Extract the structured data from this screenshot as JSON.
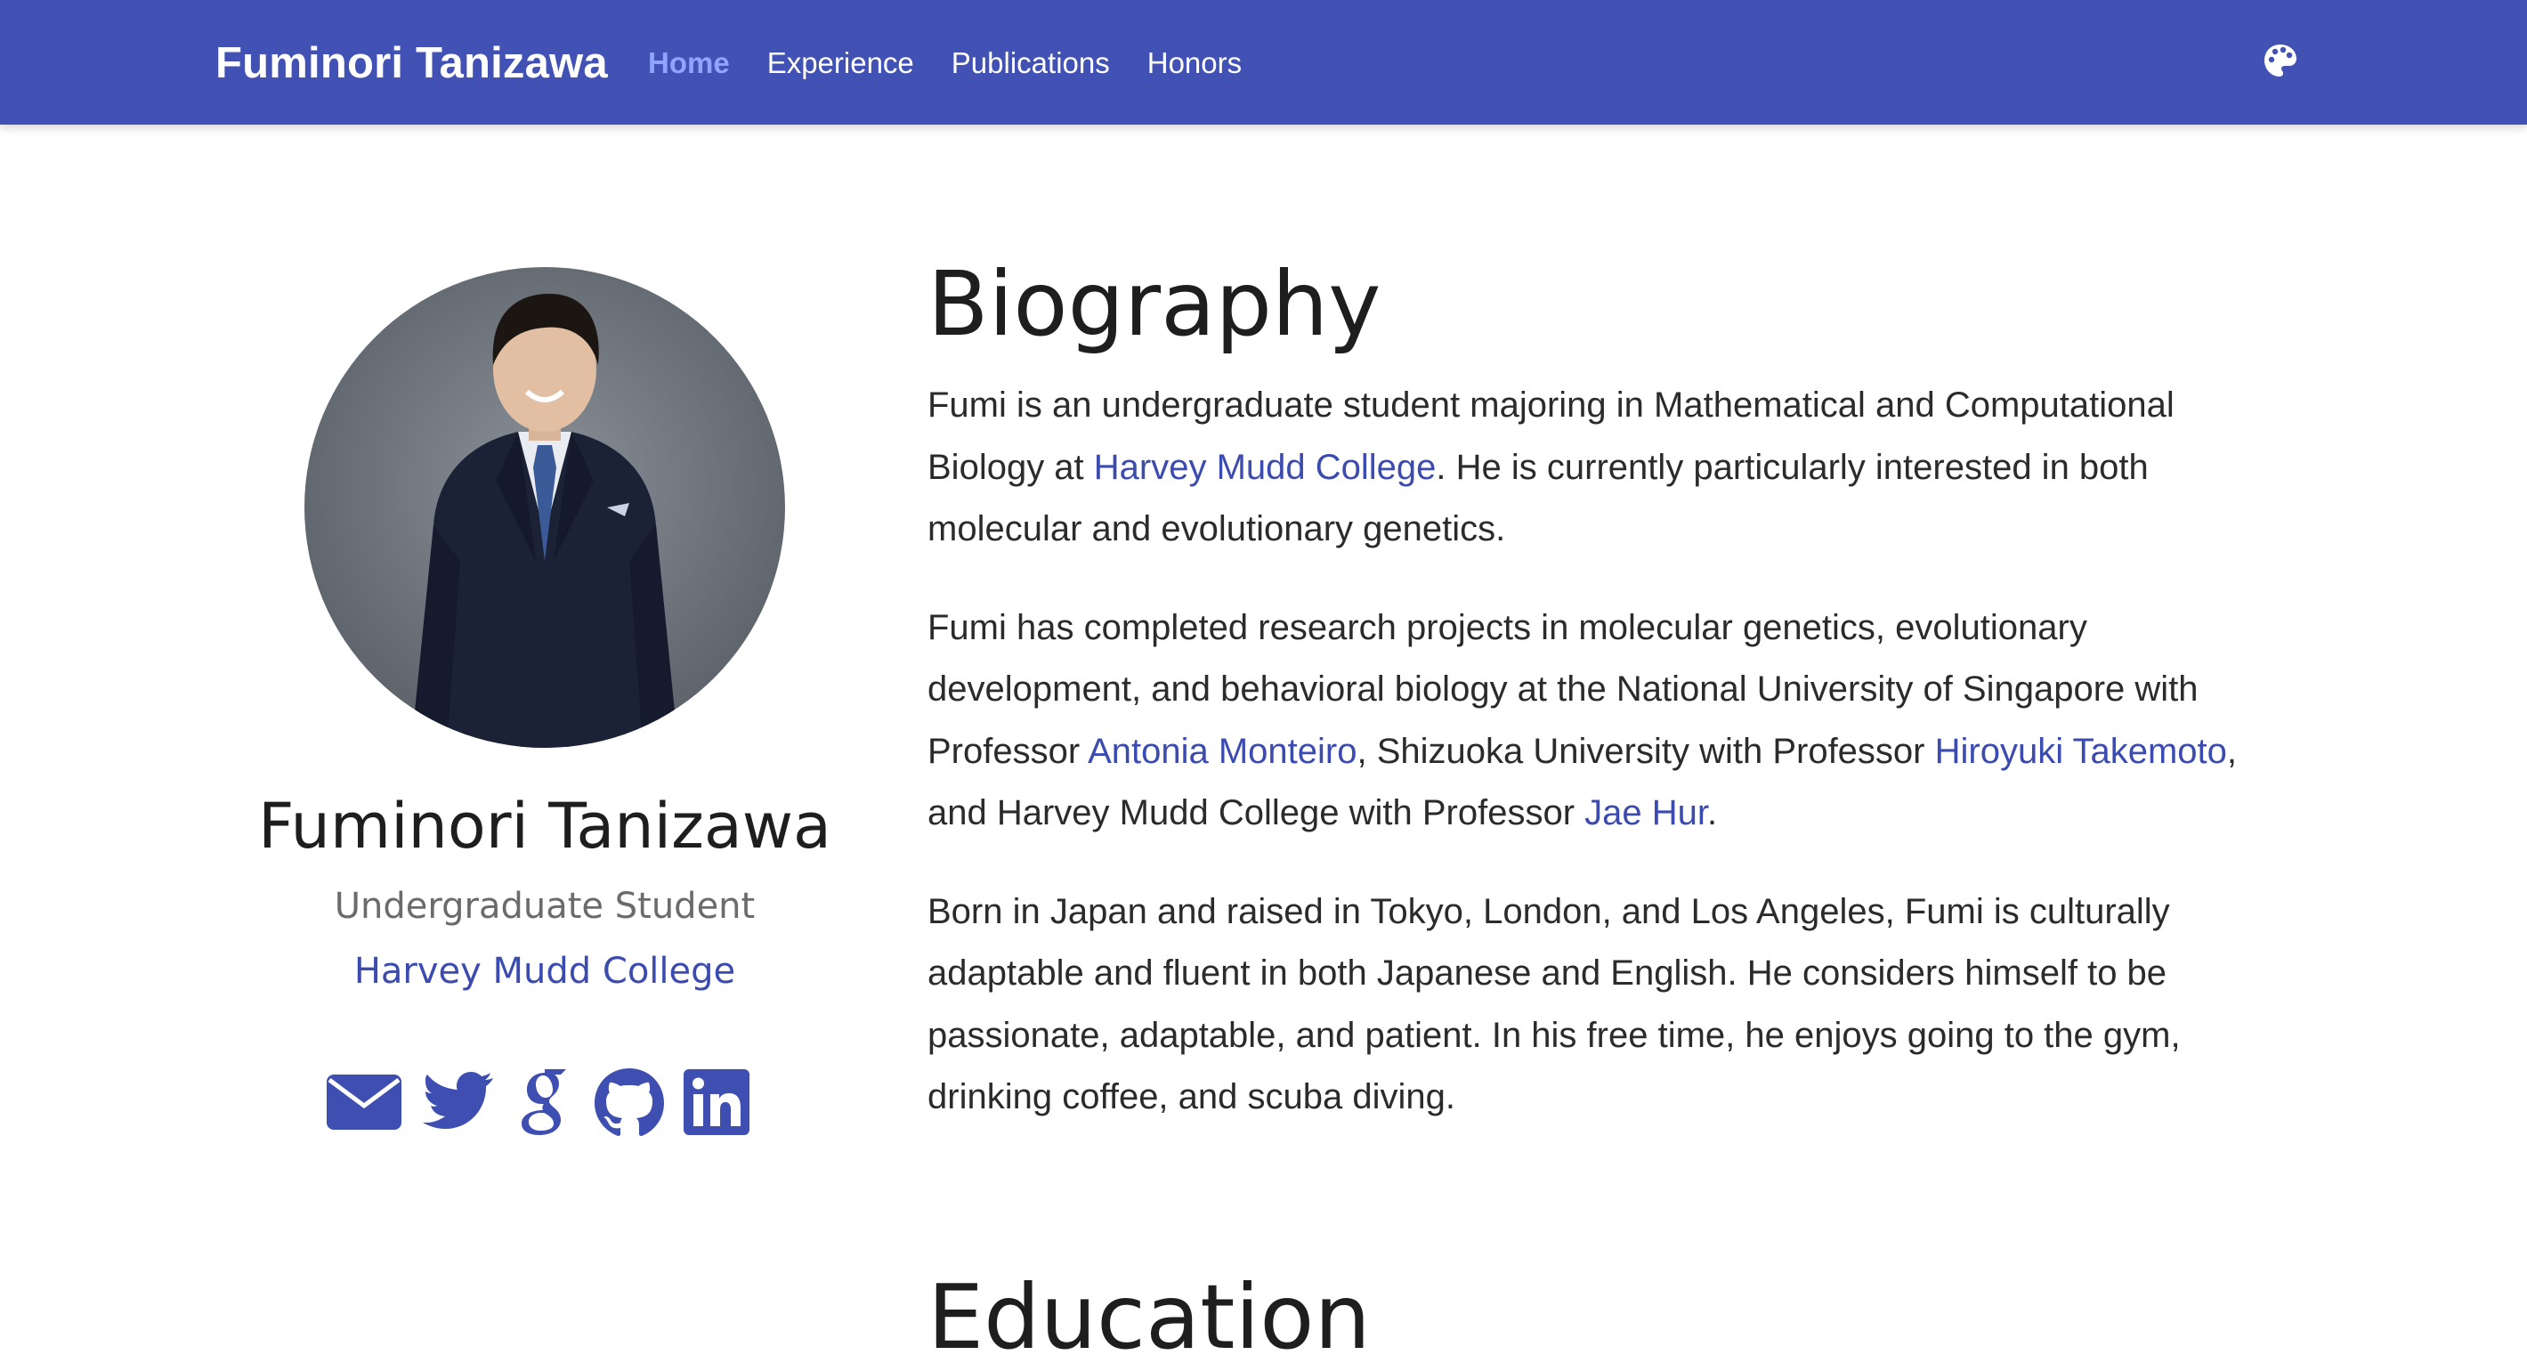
{
  "nav": {
    "brand": "Fuminori Tanizawa",
    "links": [
      {
        "label": "Home",
        "active": true
      },
      {
        "label": "Experience",
        "active": false
      },
      {
        "label": "Publications",
        "active": false
      },
      {
        "label": "Honors",
        "active": false
      }
    ],
    "theme_icon": "palette-icon"
  },
  "profile": {
    "name": "Fuminori Tanizawa",
    "role": "Undergraduate Student",
    "organization": "Harvey Mudd College",
    "social_icons": [
      "envelope-icon",
      "twitter-icon",
      "google-scholar-icon",
      "github-icon",
      "linkedin-icon"
    ]
  },
  "biography": {
    "title": "Biography",
    "p1": {
      "t1": "Fumi is an undergraduate student majoring in Mathematical and Computational Biology at ",
      "link1": "Harvey Mudd College",
      "t2": ". He is currently particularly interested in both molecular and evolutionary genetics."
    },
    "p2": {
      "t1": "Fumi has completed research projects in molecular genetics, evolutionary development, and behavioral biology at the National University of Singapore with Professor ",
      "link1": "Antonia Monteiro",
      "t2": ", Shizuoka University with Professor ",
      "link2": "Hiroyuki Takemoto",
      "t3": ", and Harvey Mudd College with Professor ",
      "link3": "Jae Hur",
      "t4": "."
    },
    "p3": "Born in Japan and raised in Tokyo, London, and Los Angeles, Fumi is culturally adaptable and fluent in both Japanese and English. He considers himself to be passionate, adaptable, and patient. In his free time, he enjoys going to the gym, drinking coffee, and scuba diving."
  },
  "education": {
    "title": "Education"
  },
  "colors": {
    "primary": "#4151b4",
    "link": "#3b4bb0",
    "active_nav": "#8fa3ff"
  }
}
